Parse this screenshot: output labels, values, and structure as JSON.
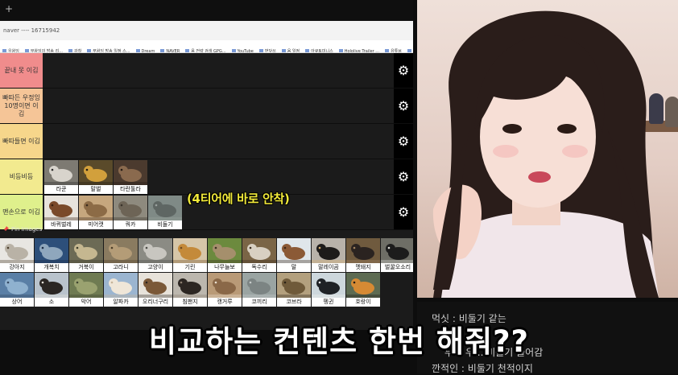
{
  "browser": {
    "url": "naver ---- 16715942",
    "bookmarks": [
      "우왕잉",
      "무왕잉의 방송 리...",
      "강착",
      "무왕잉 방송 일정 스...",
      "Dream",
      "NAVER",
      "음 전략 검색 GPG...",
      "YouTube",
      "번닷쓰",
      "움 일정",
      "아큐토미니스",
      "Hololive Trailer ...",
      "유튜브",
      "오진 무료"
    ]
  },
  "tiers": [
    {
      "label": "끝내 못 이김",
      "color": "#f08c8c",
      "items": []
    },
    {
      "label": "빠따든 우정잉 10명이면 이김",
      "color": "#f5c597",
      "items": []
    },
    {
      "label": "빠따들면 이김",
      "color": "#f6d68b",
      "items": []
    },
    {
      "label": "비등비등",
      "color": "#f2ea8f",
      "items": [
        {
          "name": "라쿤",
          "art": "raccoon"
        },
        {
          "name": "말벌",
          "art": "hornet"
        },
        {
          "name": "타란툴라",
          "art": "tarantula"
        }
      ]
    },
    {
      "label": "맨손으로 이김",
      "color": "#dff08c",
      "items": [
        {
          "name": "바퀴벌레",
          "art": "roach"
        },
        {
          "name": "미어캣",
          "art": "meerkat"
        },
        {
          "name": "쿼카",
          "art": "quokka"
        },
        {
          "name": "비둘기",
          "art": "pigeon"
        }
      ]
    }
  ],
  "tier_caption": "(4티어에 바로 안착)",
  "pool_title": "Pin Images",
  "pool": [
    [
      {
        "name": "강아지",
        "art": "dog"
      },
      {
        "name": "개복치",
        "art": "sunfish"
      },
      {
        "name": "거북이",
        "art": "turtle"
      },
      {
        "name": "고라니",
        "art": "deer"
      },
      {
        "name": "고양이",
        "art": "cat"
      },
      {
        "name": "기린",
        "art": "giraffe"
      },
      {
        "name": "나무늘보",
        "art": "sloth"
      },
      {
        "name": "독수리",
        "art": "eagle"
      },
      {
        "name": "말",
        "art": "horse"
      },
      {
        "name": "말레이곰",
        "art": "sunbear"
      },
      {
        "name": "멧돼지",
        "art": "boar"
      },
      {
        "name": "벌꿀오소리",
        "art": "badger"
      }
    ],
    [
      {
        "name": "상어",
        "art": "shark"
      },
      {
        "name": "소",
        "art": "cow"
      },
      {
        "name": "악어",
        "art": "croc"
      },
      {
        "name": "알파카",
        "art": "alpaca"
      },
      {
        "name": "오리너구리",
        "art": "platypus"
      },
      {
        "name": "침팬지",
        "art": "chimp"
      },
      {
        "name": "캥거루",
        "art": "kangaroo"
      },
      {
        "name": "코끼리",
        "art": "elephant"
      },
      {
        "name": "코브라",
        "art": "cobra"
      },
      {
        "name": "펭귄",
        "art": "penguin"
      },
      {
        "name": "호랑이",
        "art": "tiger"
      }
    ]
  ],
  "chat": [
    "먹싯 : 비둘기 같는",
    "무ㄹ 우... 비둘기 들어감",
    "깐적인 : 비둘기 천적이지"
  ],
  "subtitle": "비교하는 컨텐츠 한번 해줘??"
}
